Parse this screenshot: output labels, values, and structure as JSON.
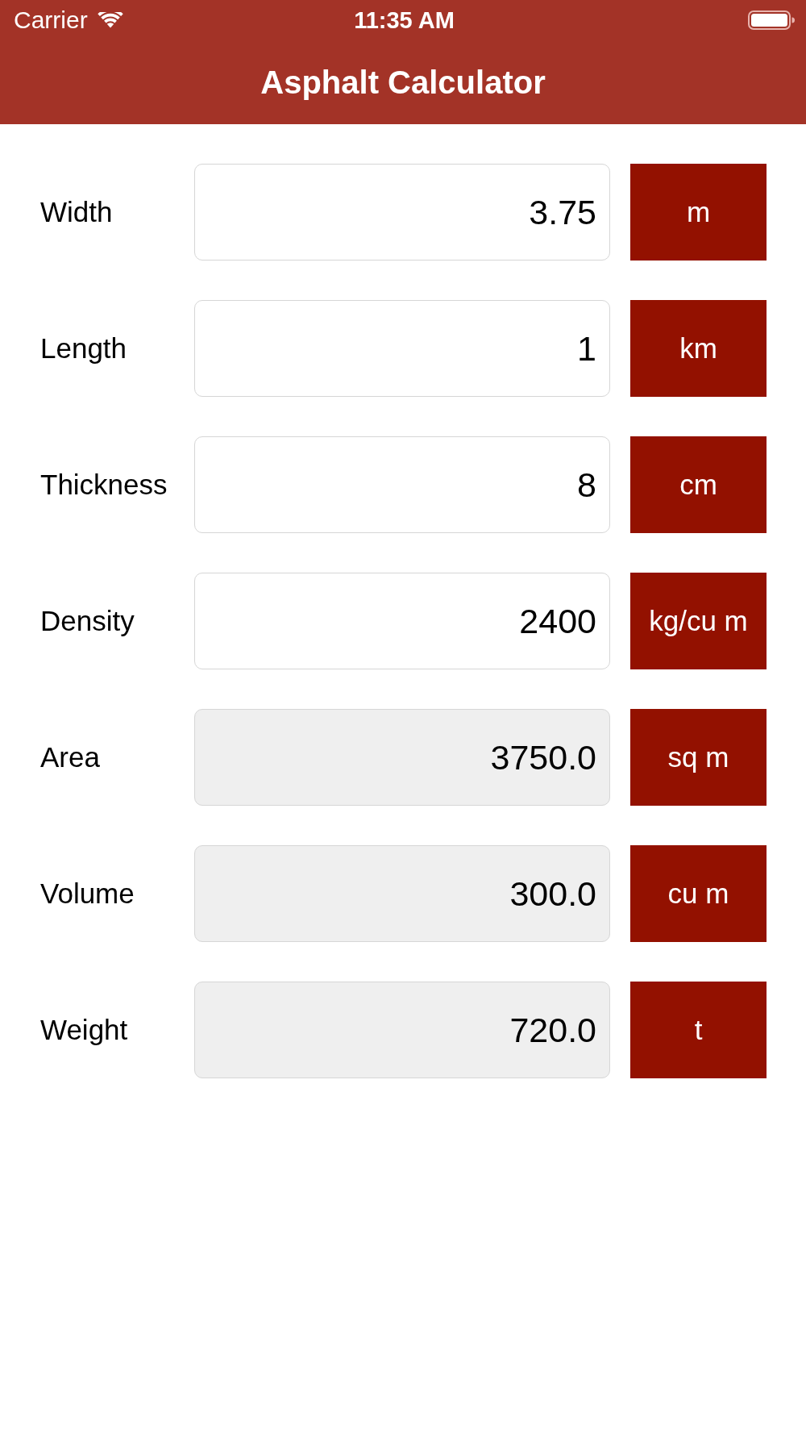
{
  "status_bar": {
    "carrier": "Carrier",
    "time": "11:35 AM"
  },
  "nav_bar": {
    "title": "Asphalt Calculator"
  },
  "rows": [
    {
      "label": "Width",
      "value": "3.75",
      "unit": "m",
      "disabled": false
    },
    {
      "label": "Length",
      "value": "1",
      "unit": "km",
      "disabled": false
    },
    {
      "label": "Thickness",
      "value": "8",
      "unit": "cm",
      "disabled": false
    },
    {
      "label": "Density",
      "value": "2400",
      "unit": "kg/cu m",
      "disabled": false
    },
    {
      "label": "Area",
      "value": "3750.0",
      "unit": "sq m",
      "disabled": true
    },
    {
      "label": "Volume",
      "value": "300.0",
      "unit": "cu m",
      "disabled": true
    },
    {
      "label": "Weight",
      "value": "720.0",
      "unit": "t",
      "disabled": true
    }
  ]
}
